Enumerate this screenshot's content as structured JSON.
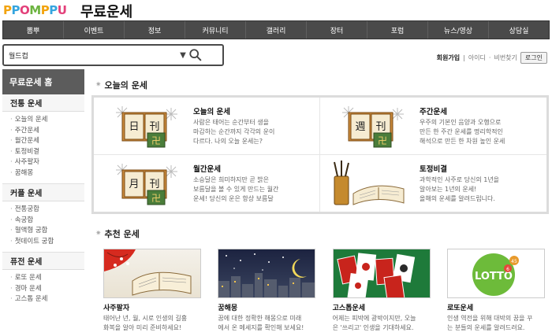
{
  "logo": {
    "letters": [
      "P",
      "P",
      "O",
      "M",
      "P",
      "P",
      "U"
    ],
    "colors": [
      "#f2a30f",
      "#35a5df",
      "#e3407a",
      "#6cb33f",
      "#f2a30f",
      "#35a5df",
      "#e3407a"
    ]
  },
  "page_title": "무료운세",
  "topnav": [
    "뽐뿌",
    "이벤트",
    "정보",
    "커뮤니티",
    "갤러리",
    "장터",
    "포럼",
    "뉴스/영상",
    "상담실"
  ],
  "search": {
    "value": "월드컵",
    "caret": "▼"
  },
  "login": {
    "join": "회원가입",
    "sep1": "|",
    "id": "아이디",
    "sep2": "·",
    "pw": "비번찾기",
    "button": "로그인"
  },
  "sidebar": {
    "home": "무료운세 홈",
    "sections": [
      {
        "title": "전통 운세",
        "items": [
          "오늘의 운세",
          "주간운세",
          "월간운세",
          "토정비결",
          "사주팔자",
          "꿈해몽"
        ]
      },
      {
        "title": "커플 운세",
        "items": [
          "전통궁합",
          "속궁합",
          "혈액형 궁합",
          "첫데이트 궁합"
        ]
      },
      {
        "title": "퓨전 운세",
        "items": [
          "로또 운세",
          "경마 운세",
          "고스톱 운세"
        ]
      }
    ]
  },
  "daily": {
    "title": "오늘의 운세",
    "cells": [
      {
        "char1": "日",
        "char2": "刊",
        "title": "오늘의 운세",
        "desc": [
          "사람은 태어는 순간부터 생을",
          "마감하는 순간까지 각각의 운이",
          "다르다. 나의 오늘 운세는?"
        ]
      },
      {
        "char1": "週",
        "char2": "刊",
        "title": "주간운세",
        "desc": [
          "우주의 기본인 음양과 오행으로",
          "만든 한 주간 운세를 명리학적인",
          "해석으로 만든 한 차원 높인 운세"
        ]
      },
      {
        "char1": "月",
        "char2": "刊",
        "title": "월간운세",
        "desc": [
          "소승달은 희미하지만 곧 밝은",
          "보름달을 볼 수 있게 만드는 월간",
          "운세! 당신의 운은 항상 보름달"
        ]
      },
      {
        "char1": "",
        "char2": "",
        "title": "토정비결",
        "desc": [
          "과학적인 사주로 당신의 1년을",
          "알아보는 1년의 운세!",
          "올해의 운세를 알려드립니다."
        ]
      }
    ]
  },
  "recommend": {
    "title": "추천 운세",
    "items": [
      {
        "title": "사주팔자",
        "desc": [
          "태어난 년, 월, 시로 인생의 길흉",
          "화복을 알아 미리 준비하세요!"
        ]
      },
      {
        "title": "꿈해몽",
        "desc": [
          "꿈에 대한 정확한 해몽으로 미래",
          "에서 온 메세지를 확인해 보세요!"
        ]
      },
      {
        "title": "고스톱운세",
        "desc": [
          "어제는 피박에 광박이지만, 오늘",
          "은 '쓰리고' 인생을 기대하세요."
        ]
      },
      {
        "title": "로또운세",
        "desc": [
          "인생 역전을 위해 대박의 꿈을 꾸",
          "는 분들의 운세를 알려드려요."
        ]
      }
    ]
  },
  "lotto_badge": "45",
  "lotto_text": "LOTTO",
  "lotto_num": "6",
  "colors": {
    "nav_bg": "#4a4a4a",
    "sidebar_home": "#5c5c5c"
  }
}
